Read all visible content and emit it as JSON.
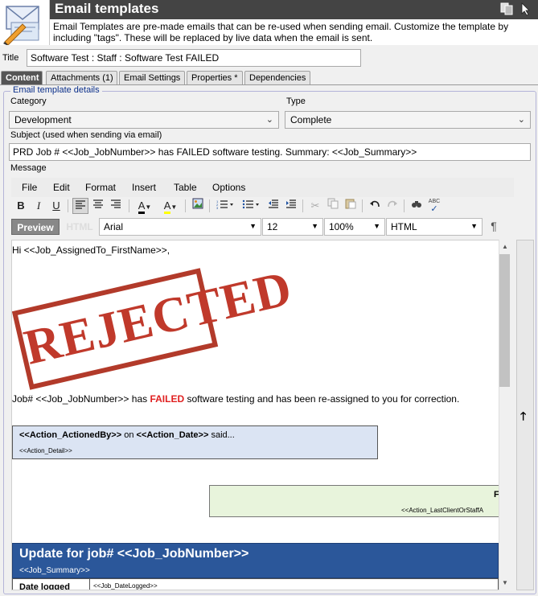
{
  "header": {
    "title": "Email templates",
    "description": "Email Templates are pre-made emails that can be re-used when sending email.  Customize the template by including \"tags\".  These will be replaced by live data when the email is sent."
  },
  "title_field": {
    "label": "Title",
    "value": "Software Test : Staff : Software Test FAILED"
  },
  "tabs": [
    {
      "label": "Content"
    },
    {
      "label": "Attachments (1)"
    },
    {
      "label": "Email Settings"
    },
    {
      "label": "Properties *"
    },
    {
      "label": "Dependencies"
    }
  ],
  "details": {
    "group_title": "Email template details",
    "category_label": "Category",
    "category_value": "Development",
    "type_label": "Type",
    "type_value": "Complete",
    "subject_label": "Subject (used when sending via email)",
    "subject_value": "PRD Job # <<Job_JobNumber>> has FAILED software testing.  Summary: <<Job_Summary>>",
    "message_label": "Message"
  },
  "editor_menu": {
    "file": "File",
    "edit": "Edit",
    "format": "Format",
    "insert": "Insert",
    "table": "Table",
    "options": "Options"
  },
  "format_bar": {
    "preview": "Preview",
    "html": "HTML",
    "font": "Arial",
    "size": "12",
    "zoom": "100%",
    "mode": "HTML"
  },
  "toolbar_glyphs": {
    "bold": "B",
    "italic": "I",
    "underline": "U",
    "font_color": "A",
    "highlight": "A",
    "pilcrow": "¶",
    "spell": "ABC",
    "scroll_top": "🡑"
  },
  "message": {
    "greeting": "Hi <<Job_AssignedTo_FirstName>>,",
    "stamp": "REJECTED",
    "line_pre": "Job# <<Job_JobNumber>> has ",
    "line_failed": "FAILED",
    "line_post": " software testing and has been re-assigned to you for correction.",
    "action_by": "<<Action_ActionedBy>>",
    "action_on": " on ",
    "action_date": "<<Action_Date>>",
    "action_said": " said...",
    "action_detail": "<<Action_Detail>>",
    "green_partial": "F",
    "green_detail": "<<Action_LastClientOrStaffA",
    "update_title": "Update for job# <<Job_JobNumber>>",
    "update_summary": "<<Job_Summary>>",
    "date_logged_label": "Date logged",
    "date_logged_value": "<<Job_DateLogged>>"
  }
}
